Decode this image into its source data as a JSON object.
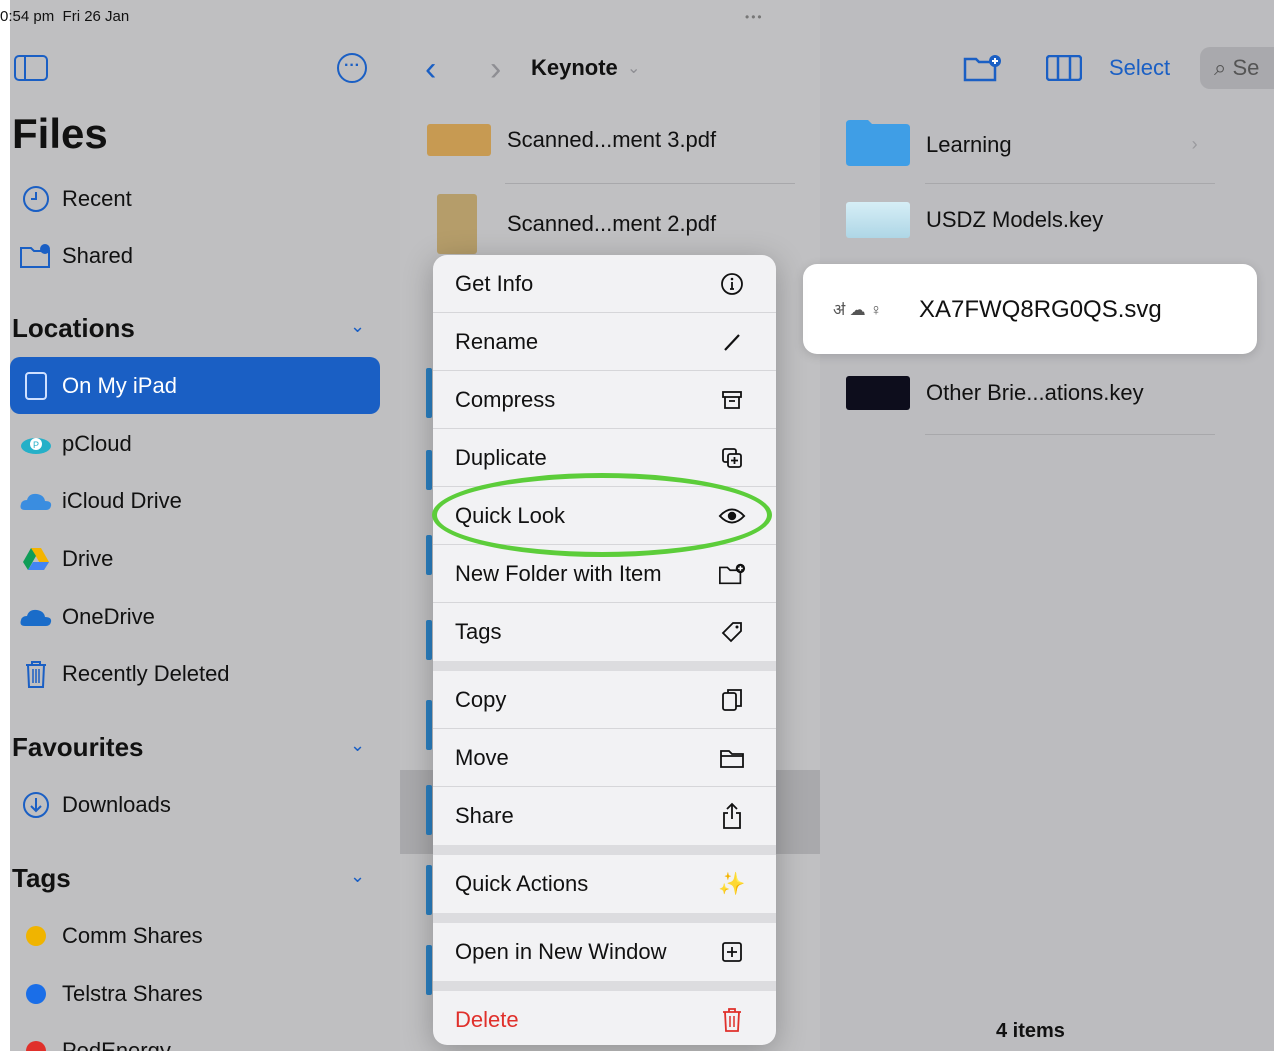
{
  "status": {
    "time": "0:54 pm",
    "date": "Fri 26 Jan"
  },
  "sidebar": {
    "title": "Files",
    "top_items": [
      {
        "label": "Recent",
        "icon": "clock-icon"
      },
      {
        "label": "Shared",
        "icon": "shared-folder-icon"
      }
    ],
    "locations_header": "Locations",
    "locations": [
      {
        "label": "On My iPad",
        "icon": "ipad-icon"
      },
      {
        "label": "pCloud",
        "icon": "pcloud-icon"
      },
      {
        "label": "iCloud Drive",
        "icon": "icloud-icon"
      },
      {
        "label": "Drive",
        "icon": "google-drive-icon"
      },
      {
        "label": "OneDrive",
        "icon": "onedrive-icon"
      },
      {
        "label": "Recently Deleted",
        "icon": "trash-icon"
      }
    ],
    "favourites_header": "Favourites",
    "favourites": [
      {
        "label": "Downloads",
        "icon": "download-icon"
      }
    ],
    "tags_header": "Tags",
    "tags": [
      {
        "label": "Comm Shares",
        "color": "#f0b400"
      },
      {
        "label": "Telstra Shares",
        "color": "#1a6ee8"
      },
      {
        "label": "PodEnergy",
        "color": "#e0302b"
      }
    ]
  },
  "toolbar": {
    "folder": "Keynote",
    "select_label": "Select",
    "search_placeholder": "Se"
  },
  "middle_files": [
    {
      "name": "Scanned...ment 3.pdf"
    },
    {
      "name": "Scanned...ment 2.pdf"
    }
  ],
  "right_files": [
    {
      "name": "Learning"
    },
    {
      "name": "USDZ Models.key"
    },
    {
      "name": "XA7FWQ8RG0QS.svg"
    },
    {
      "name": "Other Brie...ations.key"
    }
  ],
  "items_count": "4 items",
  "menu": {
    "items": [
      {
        "label": "Get Info",
        "icon": "info-icon"
      },
      {
        "label": "Rename",
        "icon": "pencil-icon"
      },
      {
        "label": "Compress",
        "icon": "archive-box-icon"
      },
      {
        "label": "Duplicate",
        "icon": "duplicate-icon"
      },
      {
        "label": "Quick Look",
        "icon": "eye-icon"
      },
      {
        "label": "New Folder with Item",
        "icon": "folder-plus-icon"
      },
      {
        "label": "Tags",
        "icon": "tag-icon"
      },
      {
        "label": "Copy",
        "icon": "copy-icon"
      },
      {
        "label": "Move",
        "icon": "folder-icon"
      },
      {
        "label": "Share",
        "icon": "share-icon"
      },
      {
        "label": "Quick Actions",
        "icon": "sparkles-icon"
      },
      {
        "label": "Open in New Window",
        "icon": "plus-square-icon"
      },
      {
        "label": "Delete",
        "icon": "trash-icon"
      }
    ]
  },
  "colors": {
    "accent": "#1a5fc4",
    "danger": "#e0302b",
    "highlight": "#5ccd3a"
  }
}
